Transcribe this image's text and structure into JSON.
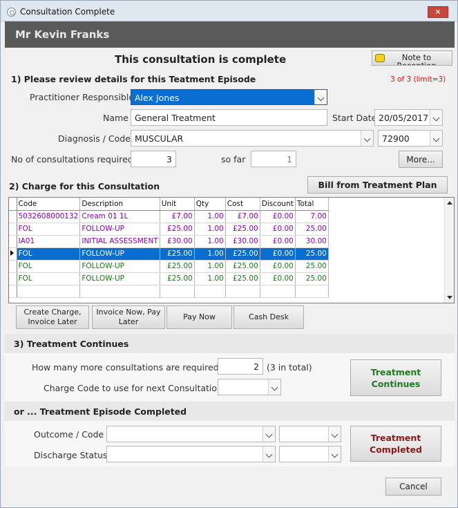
{
  "window": {
    "title": "Consultation Complete",
    "close": "✕"
  },
  "header": {
    "patient_name": "Mr Kevin Franks"
  },
  "banner": {
    "title": "This consultation is complete",
    "note_button": "Note to Reception"
  },
  "episode": {
    "heading": "1) Please review details for this Teatment Episode",
    "limit_text": "3 of 3 (limit=3)",
    "practitioner_label": "Practitioner Responsible",
    "practitioner_value": "Alex Jones",
    "name_label": "Name",
    "name_value": "General Treatment",
    "start_date_label": "Start Date",
    "start_date_value": "20/05/2017",
    "diagnosis_label": "Diagnosis / Code",
    "diagnosis_value": "MUSCULAR",
    "diagnosis_code": "72900",
    "consults_required_label": "No of consultations required",
    "consults_required_value": "3",
    "so_far_label": "so far",
    "so_far_value": "1",
    "more_button": "More..."
  },
  "charge": {
    "heading": "2) Charge for this Consultation",
    "bill_button": "Bill from Treatment Plan",
    "columns": [
      "Code",
      "Description",
      "Unit",
      "Qty",
      "Cost",
      "Discount",
      "Total"
    ],
    "rows": [
      {
        "code": "5032608000132",
        "description": "Cream 01 1L",
        "unit": "£7.00",
        "qty": "1.00",
        "cost": "£7.00",
        "discount": "£0.00",
        "total": "7.00",
        "color": "purple"
      },
      {
        "code": "FOL",
        "description": "FOLLOW-UP",
        "unit": "£25.00",
        "qty": "1.00",
        "cost": "£25.00",
        "discount": "£0.00",
        "total": "25.00",
        "color": "purple"
      },
      {
        "code": "IA01",
        "description": "INITIAL ASSESSMENT",
        "unit": "£30.00",
        "qty": "1.00",
        "cost": "£30.00",
        "discount": "£0.00",
        "total": "30.00",
        "color": "purple"
      },
      {
        "code": "FOL",
        "description": "FOLLOW-UP",
        "unit": "£25.00",
        "qty": "1.00",
        "cost": "£25.00",
        "discount": "£0.00",
        "total": "25.00",
        "color": "selected"
      },
      {
        "code": "FOL",
        "description": "FOLLOW-UP",
        "unit": "£25.00",
        "qty": "1.00",
        "cost": "£25.00",
        "discount": "£0.00",
        "total": "25.00",
        "color": "green"
      },
      {
        "code": "FOL",
        "description": "FOLLOW-UP",
        "unit": "£25.00",
        "qty": "1.00",
        "cost": "£25.00",
        "discount": "£0.00",
        "total": "25.00",
        "color": "green"
      }
    ],
    "buttons": {
      "create_charge": "Create Charge, Invoice Later",
      "invoice_now": "Invoice Now, Pay Later",
      "pay_now": "Pay Now",
      "cash_desk": "Cash Desk"
    }
  },
  "continues": {
    "heading": "3) Treatment Continues",
    "more_label": "How many more consultations are required?",
    "more_value": "2",
    "total_text": "(3 in total)",
    "charge_code_label": "Charge Code to use for next Consultation",
    "charge_code_value": "",
    "button": "Treatment Continues"
  },
  "completed": {
    "heading": "or ... Treatment Episode Completed",
    "outcome_label": "Outcome / Code",
    "discharge_label": "Discharge Status",
    "button": "Treatment Completed"
  },
  "footer": {
    "cancel": "Cancel"
  }
}
